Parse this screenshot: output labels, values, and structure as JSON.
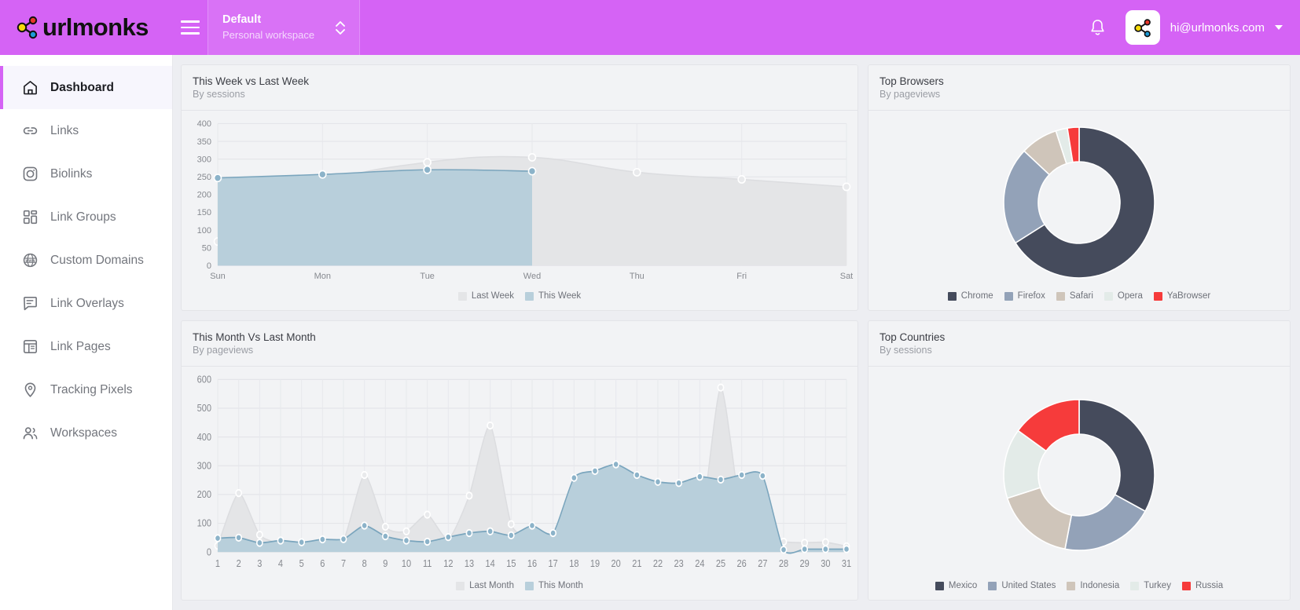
{
  "header": {
    "brand": "urlmonks",
    "logo_icon": "urlmonks-node-logo",
    "menu_icon": "hamburger-menu-icon",
    "workspace": {
      "name": "Default",
      "subtitle": "Personal workspace",
      "switch_icon": "chevron-up-down-icon"
    },
    "notifications_icon": "bell-icon",
    "account_email": "hi@urlmonks.com",
    "account_caret_icon": "chevron-down-icon",
    "bar_color": "#d563f5"
  },
  "sidebar": {
    "items": [
      {
        "label": "Dashboard",
        "icon": "home-icon",
        "active": true
      },
      {
        "label": "Links",
        "icon": "link-icon",
        "active": false
      },
      {
        "label": "Biolinks",
        "icon": "camera-icon",
        "active": false
      },
      {
        "label": "Link Groups",
        "icon": "grid-icon",
        "active": false
      },
      {
        "label": "Custom Domains",
        "icon": "globe-www-icon",
        "active": false
      },
      {
        "label": "Link Overlays",
        "icon": "overlay-icon",
        "active": false
      },
      {
        "label": "Link Pages",
        "icon": "page-layout-icon",
        "active": false
      },
      {
        "label": "Tracking Pixels",
        "icon": "map-pin-icon",
        "active": false
      },
      {
        "label": "Workspaces",
        "icon": "users-icon",
        "active": false
      }
    ],
    "active_accent": "#d563f5"
  },
  "cards": {
    "week": {
      "title": "This Week vs Last Week",
      "subtitle": "By sessions"
    },
    "month": {
      "title": "This Month Vs Last Month",
      "subtitle": "By pageviews"
    },
    "browsers": {
      "title": "Top Browsers",
      "subtitle": "By pageviews"
    },
    "countries": {
      "title": "Top Countries",
      "subtitle": "By sessions"
    }
  },
  "chart_data": [
    {
      "id": "week",
      "type": "area",
      "title": "This Week vs Last Week",
      "subtitle": "By sessions",
      "xlabel": "",
      "ylabel": "",
      "categories": [
        "Sun",
        "Mon",
        "Tue",
        "Wed",
        "Thu",
        "Fri",
        "Sat"
      ],
      "ylim": [
        0,
        400
      ],
      "yticks": [
        0,
        50,
        100,
        150,
        200,
        250,
        300,
        350,
        400
      ],
      "grid": true,
      "legend_position": "bottom",
      "series": [
        {
          "name": "Last Week",
          "color": "#e4e5e7",
          "values": [
            68,
            228,
            291,
            305,
            263,
            243,
            222
          ]
        },
        {
          "name": "This Week",
          "color": "#b8cfdb",
          "values": [
            247,
            257,
            270,
            266,
            null,
            null,
            null
          ]
        }
      ]
    },
    {
      "id": "month",
      "type": "area",
      "title": "This Month Vs Last Month",
      "subtitle": "By pageviews",
      "xlabel": "",
      "ylabel": "",
      "categories": [
        "1",
        "2",
        "3",
        "4",
        "5",
        "6",
        "7",
        "8",
        "9",
        "10",
        "11",
        "12",
        "13",
        "14",
        "15",
        "16",
        "17",
        "18",
        "19",
        "20",
        "21",
        "22",
        "23",
        "24",
        "25",
        "26",
        "27",
        "28",
        "29",
        "30",
        "31"
      ],
      "ylim": [
        0,
        600
      ],
      "yticks": [
        0,
        100,
        200,
        300,
        400,
        500,
        600
      ],
      "grid": true,
      "legend_position": "bottom",
      "series": [
        {
          "name": "Last Month",
          "color": "#e4e5e7",
          "values": [
            22,
            205,
            60,
            30,
            25,
            28,
            40,
            268,
            88,
            72,
            130,
            45,
            196,
            440,
            97,
            48,
            22,
            20,
            60,
            85,
            78,
            50,
            42,
            60,
            572,
            118,
            52,
            36,
            32,
            34,
            20
          ]
        },
        {
          "name": "This Month",
          "color": "#b8cfdb",
          "values": [
            48,
            50,
            32,
            40,
            34,
            44,
            45,
            92,
            55,
            40,
            36,
            52,
            66,
            72,
            58,
            92,
            66,
            258,
            282,
            305,
            268,
            244,
            240,
            262,
            252,
            268,
            265,
            8,
            10,
            10,
            10
          ]
        }
      ]
    },
    {
      "id": "browsers",
      "type": "pie",
      "title": "Top Browsers",
      "subtitle": "By pageviews",
      "legend_position": "bottom",
      "labels": [
        "Chrome",
        "Firefox",
        "Safari",
        "Opera",
        "YaBrowser"
      ],
      "values": [
        66,
        21,
        8,
        2.5,
        2.5
      ],
      "colors": [
        "#454b5c",
        "#93a2b8",
        "#cfc5ba",
        "#e3ebe8",
        "#f63b3b"
      ]
    },
    {
      "id": "countries",
      "type": "pie",
      "title": "Top Countries",
      "subtitle": "By sessions",
      "legend_position": "bottom",
      "labels": [
        "Mexico",
        "United States",
        "Indonesia",
        "Turkey",
        "Russia"
      ],
      "values": [
        33,
        20,
        17,
        15,
        15
      ],
      "colors": [
        "#454b5c",
        "#93a2b8",
        "#cfc5ba",
        "#e3ebe8",
        "#f63b3b"
      ]
    }
  ]
}
